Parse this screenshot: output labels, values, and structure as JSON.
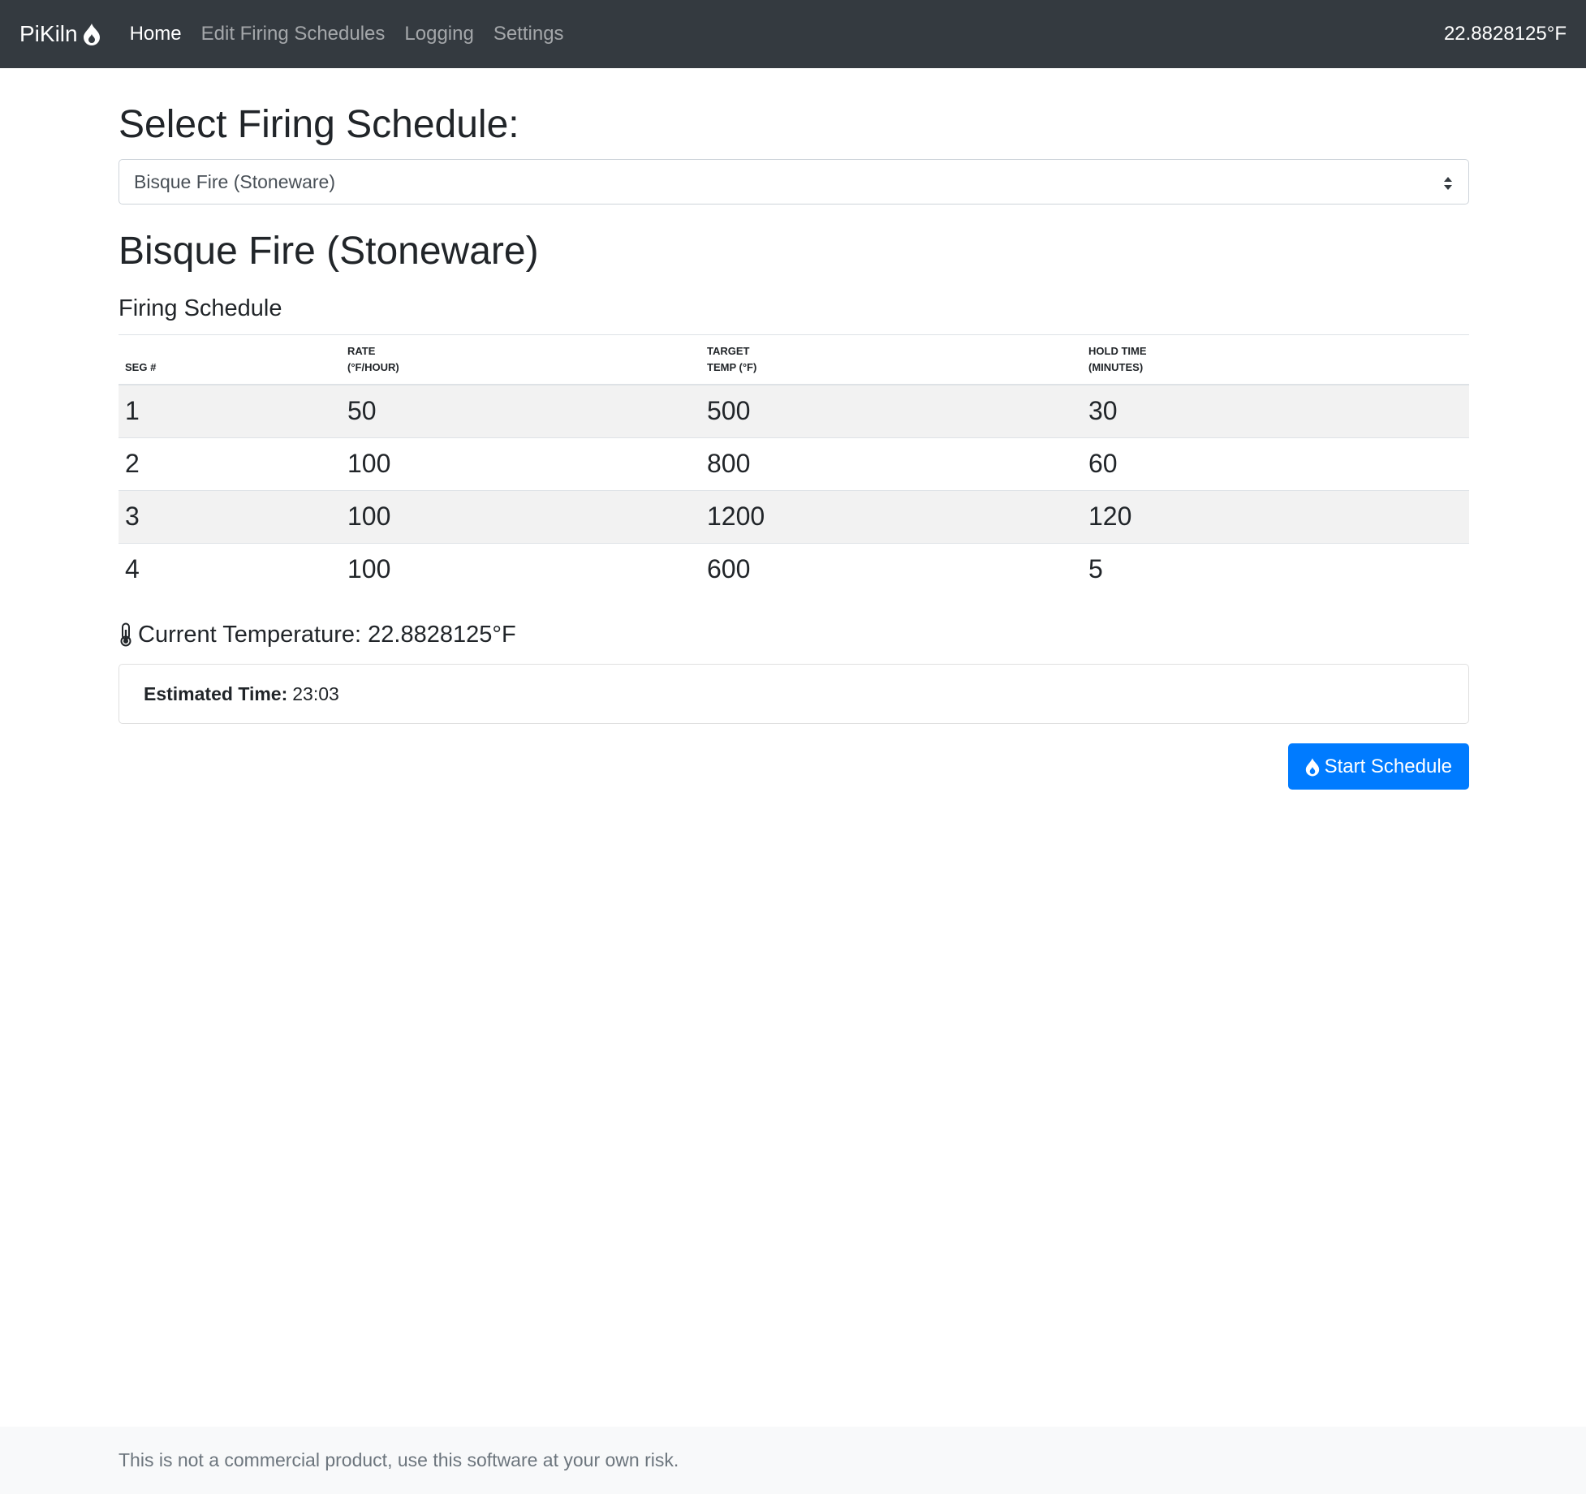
{
  "navbar": {
    "brand": "PiKiln",
    "brand_icon": "fire-icon",
    "links": [
      {
        "label": "Home",
        "active": true
      },
      {
        "label": "Edit Firing Schedules",
        "active": false
      },
      {
        "label": "Logging",
        "active": false
      },
      {
        "label": "Settings",
        "active": false
      }
    ],
    "temperature": "22.8828125°F"
  },
  "main": {
    "select_title": "Select Firing Schedule:",
    "select_value": "Bisque Fire (Stoneware)",
    "schedule_name": "Bisque Fire (Stoneware)",
    "section_title": "Firing Schedule",
    "table": {
      "headers": [
        {
          "line1": "",
          "line2": "Seg #"
        },
        {
          "line1": "Rate",
          "line2": "(°F/hour)"
        },
        {
          "line1": "Target",
          "line2": "Temp (°F)"
        },
        {
          "line1": "Hold Time",
          "line2": "(minutes)"
        }
      ],
      "rows": [
        [
          "1",
          "50",
          "500",
          "30"
        ],
        [
          "2",
          "100",
          "800",
          "60"
        ],
        [
          "3",
          "100",
          "1200",
          "120"
        ],
        [
          "4",
          "100",
          "600",
          "5"
        ]
      ]
    },
    "current_temp_icon": "thermometer-icon",
    "current_temp_text": "Current Temperature: 22.8828125°F",
    "estimated_label": "Estimated Time:",
    "estimated_value": "23:03",
    "start_button_label": "Start Schedule",
    "start_button_icon": "fire-icon"
  },
  "footer": {
    "text": "This is not a commercial product, use this software at your own risk."
  },
  "colors": {
    "navbar_bg": "#343a40",
    "primary": "#007bff",
    "footer_bg": "#f8f9fa",
    "striped_row": "#f2f2f2"
  }
}
